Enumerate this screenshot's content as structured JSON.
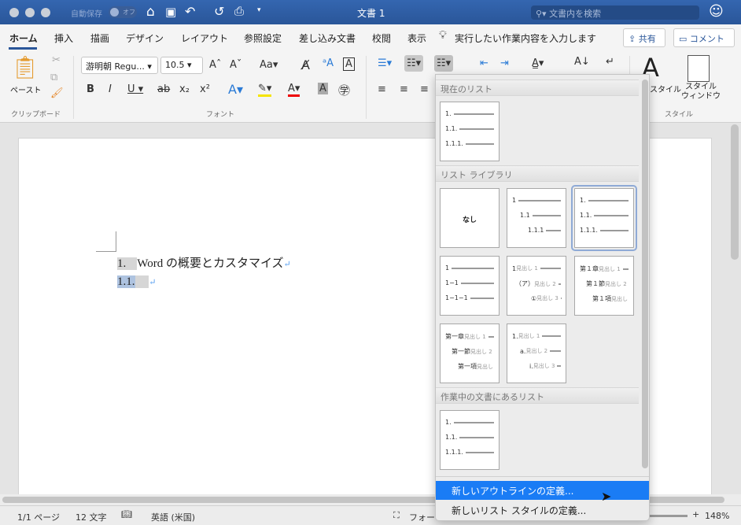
{
  "titlebar": {
    "autosave_label": "自動保存",
    "autosave_state": "オフ",
    "title": "文書 1",
    "search_placeholder": "文書内を検索"
  },
  "tabs": [
    {
      "label": "ホーム",
      "active": true
    },
    {
      "label": "挿入"
    },
    {
      "label": "描画"
    },
    {
      "label": "デザイン"
    },
    {
      "label": "レイアウト"
    },
    {
      "label": "参照設定"
    },
    {
      "label": "差し込み文書"
    },
    {
      "label": "校閲"
    },
    {
      "label": "表示"
    }
  ],
  "tell_me": "実行したい作業内容を入力します",
  "share_label": "共有",
  "comment_label": "コメント",
  "ribbon": {
    "paste_label": "ペースト",
    "clipboard_group": "クリップボード",
    "font_group": "フォント",
    "font_name": "游明朝 Regu...",
    "font_size": "10.5",
    "style_label": "スタイル",
    "style_window_label": "スタイル\nウィンドウ",
    "style_group": "スタイル"
  },
  "document": {
    "line1_number": "1.",
    "line1_text": "Word の概要とカスタマイズ",
    "line2_number": "1.1.",
    "para_mark": "↵"
  },
  "dropdown": {
    "current_header": "現在のリスト",
    "library_header": "リスト ライブラリ",
    "doc_header": "作業中の文書にあるリスト",
    "none_label": "なし",
    "current": [
      [
        {
          "t": "1."
        },
        {
          "t": "1.1."
        },
        {
          "t": "1.1.1."
        }
      ]
    ],
    "library": [
      [
        {
          "t": "1",
          "i": 0
        },
        {
          "t": "1.1",
          "i": 10
        },
        {
          "t": "1.1.1",
          "i": 20
        }
      ],
      [
        {
          "t": "1."
        },
        {
          "t": "1.1."
        },
        {
          "t": "1.1.1."
        }
      ],
      [
        {
          "t": "1"
        },
        {
          "t": "1−1"
        },
        {
          "t": "1−1−1"
        }
      ],
      [
        {
          "t": "1",
          "s": "見出し 1",
          "i": 0
        },
        {
          "t": "（ア）",
          "s": "見出し 2",
          "i": 4
        },
        {
          "t": "①",
          "s": "見出し 3",
          "i": 24
        }
      ],
      [
        {
          "t": "第１章",
          "s": "見出し 1",
          "i": 0
        },
        {
          "t": "第１節",
          "s": "見出し 2",
          "i": 8
        },
        {
          "t": "第１項",
          "s": "見出し",
          "i": 16
        }
      ],
      [
        {
          "t": "第一章",
          "s": "見出し 1",
          "i": 0
        },
        {
          "t": "第一節",
          "s": "見出し 2",
          "i": 8
        },
        {
          "t": "第一項",
          "s": "見出し",
          "i": 16
        }
      ],
      [
        {
          "t": "1.",
          "s": "見出し 1",
          "i": 0
        },
        {
          "t": "a.",
          "s": "見出し 2",
          "i": 10
        },
        {
          "t": "i.",
          "s": "見出し 3",
          "i": 22
        }
      ]
    ],
    "doc": [
      [
        {
          "t": "1."
        },
        {
          "t": "1.1."
        },
        {
          "t": "1.1.1."
        }
      ]
    ],
    "menu": [
      "新しいアウトラインの定義...",
      "新しいリスト スタイルの定義..."
    ]
  },
  "status": {
    "page": "1/1 ページ",
    "words": "12 文字",
    "language": "英語 (米国)",
    "focus": "フォー",
    "zoom": "148%"
  },
  "colors": {
    "titlebar": "#2a5699",
    "highlight": "#1a7cf5",
    "accent_tab": "#2a5699"
  }
}
